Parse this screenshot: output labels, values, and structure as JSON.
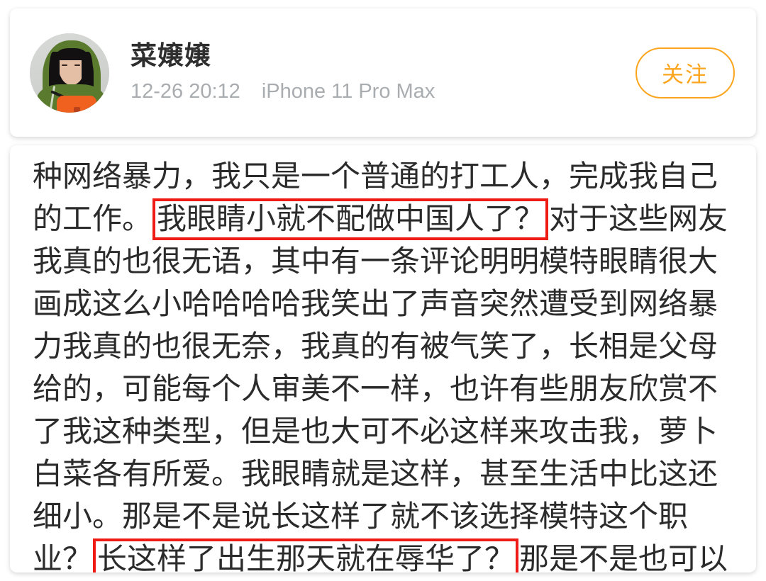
{
  "colors": {
    "accent_orange": "#fba61e",
    "highlight_red": "#ee1c14",
    "text_primary": "#2b2b2b",
    "text_meta": "#a9adb0",
    "card_background": "#ffffff",
    "page_background": "#ffffff"
  },
  "header": {
    "avatar_alt": "user-avatar-photo",
    "username": "菜嬢嬢",
    "timestamp": "12-26 20:12",
    "device": "iPhone 11 Pro Max",
    "follow_label": "关注"
  },
  "post": {
    "segments": [
      {
        "type": "text",
        "value": "种网络暴力，我只是一个普通的打工人，完成我自己的工作。"
      },
      {
        "type": "highlight",
        "value": "我眼睛小就不配做中国人了？"
      },
      {
        "type": "text",
        "value": "对于这些网友我真的也很无语，其中有一条评论明明模特眼睛很大画成这么小哈哈哈哈我笑出了声音突然遭受到网络暴力我真的也很无奈，我真的有被气笑了，长相是父母给的，可能每个人审美不一样，也许有些朋友欣赏不了我这种类型，但是也大可不必这样来攻击我，萝卜白菜各有所爱。我眼睛就是这样，甚至生活中比这还细小。那是不是说长这样了就不该选择模特这个职业？"
      },
      {
        "type": "highlight",
        "value": "长这样了出生那天就在辱华了？"
      },
      {
        "type": "text",
        "value": "那是不是也可以"
      }
    ],
    "lines": [
      "种网络暴力，我只是一个普通的打工人，完成我自己",
      "的工作。我眼睛小就不配做中国人了？对于这些网友",
      "我真的也很无语，其中有一条评论明明模特眼睛很大",
      "画成这么小哈哈哈哈我笑出了声音突然遭受到网络暴",
      "力我真的也很无奈，我真的有被气笑了，长相是父母",
      "给的，可能每个人审美不一样，也许有些朋友欣赏不",
      "了我这种类型，但是也大可不必这样来攻击我，萝卜",
      "白菜各有所爱。我眼睛就是这样，甚至生活中比这还",
      "细小。那是不是说长这样了就不该选择模特这个职",
      "业？长这样了出生那天就在辱华了？那是不是也可以"
    ]
  }
}
